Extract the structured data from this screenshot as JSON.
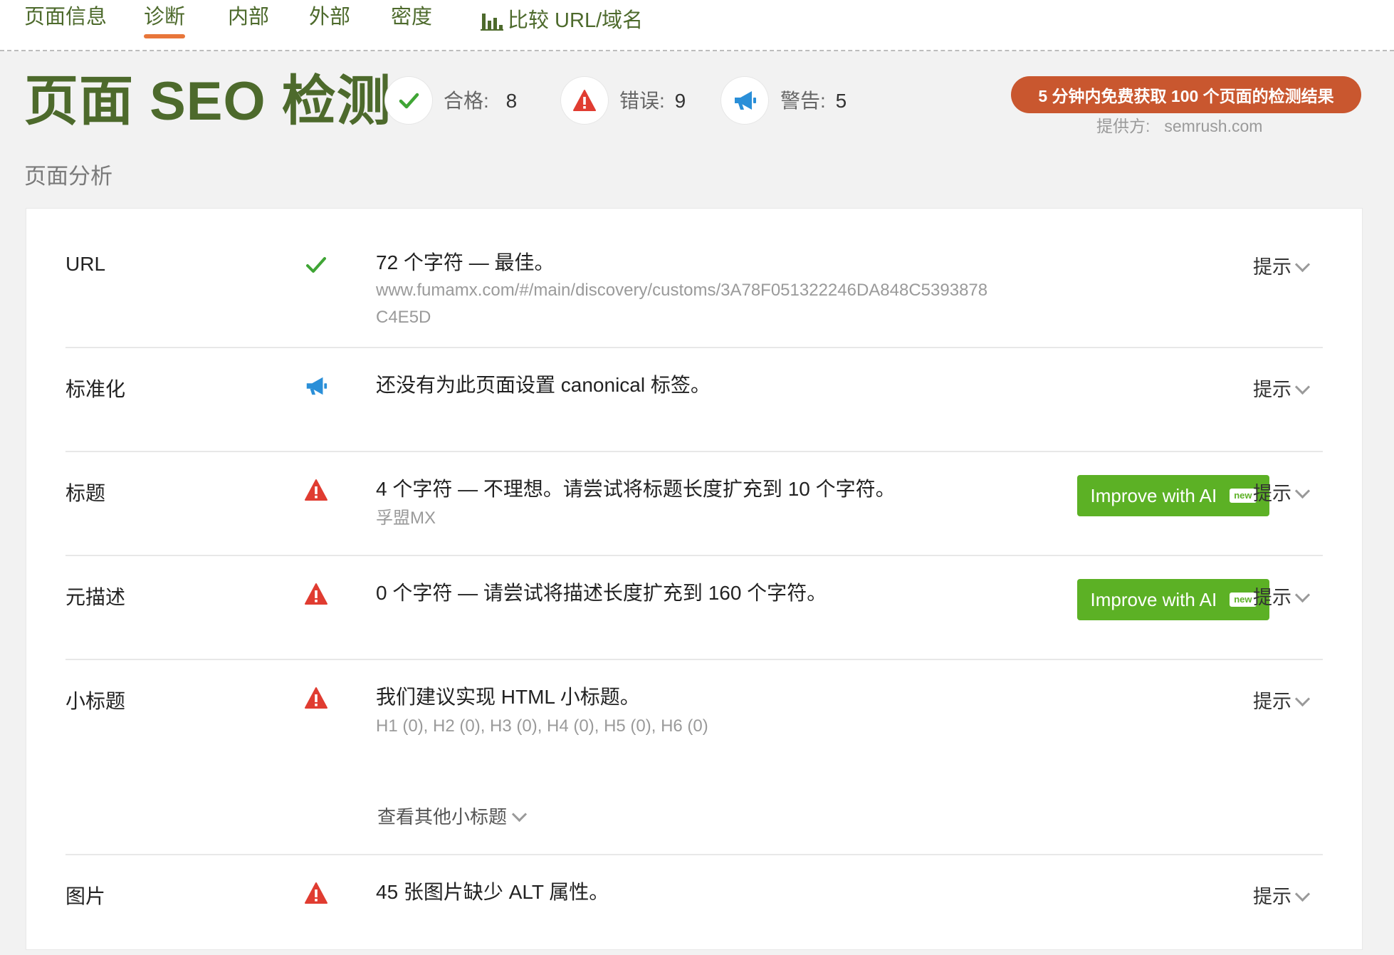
{
  "nav": {
    "items": [
      "页面信息",
      "诊断",
      "内部",
      "外部",
      "密度"
    ],
    "active": "诊断",
    "compare_label": "比较 URL/域名"
  },
  "header": {
    "title": "页面 SEO 检测",
    "stats": {
      "pass_label": "合格:",
      "pass_count": "8",
      "error_label": "错误:",
      "error_count": "9",
      "warning_label": "警告:",
      "warning_count": "5"
    },
    "promo_label": "5 分钟内免费获取 100 个页面的检测结果",
    "provider_label": "提供方:",
    "provider_host": "semrush.com"
  },
  "section_title": "页面分析",
  "hint_label": "提示",
  "improve_label": "Improve with AI",
  "new_badge": "new",
  "rows": [
    {
      "label": "URL",
      "status": "pass",
      "icon": "check-icon",
      "message": "72 个字符 — 最佳。",
      "details": [
        "www.fumamx.com/#/main/discovery/customs/3A78F051322246DA848C5393878",
        "C4E5D"
      ]
    },
    {
      "label": "标准化",
      "status": "warning",
      "icon": "megaphone-icon",
      "message": "还没有为此页面设置 canonical 标签。"
    },
    {
      "label": "标题",
      "status": "error",
      "icon": "warning-triangle-icon",
      "message": "4 个字符 — 不理想。请尝试将标题长度扩充到 10 个字符。",
      "details": [
        "孚盟MX"
      ]
    },
    {
      "label": "元描述",
      "status": "error",
      "icon": "warning-triangle-icon",
      "message": "0 个字符 — 请尝试将描述长度扩充到 160 个字符。"
    },
    {
      "label": "小标题",
      "status": "error",
      "icon": "warning-triangle-icon",
      "message": "我们建议实现 HTML 小标题。",
      "details": [
        "H1 (0), H2 (0), H3 (0), H4 (0), H5 (0), H6 (0)"
      ],
      "more_label": "查看其他小标题"
    },
    {
      "label": "图片",
      "status": "error",
      "icon": "warning-triangle-icon",
      "message": "45 张图片缺少 ALT 属性。"
    }
  ],
  "colors": {
    "brand_green": "#4d6a2c",
    "active_underline": "#e8763a",
    "promo": "#c9572f",
    "pass": "#3fa535",
    "error": "#e03c31",
    "warning": "#2a8fd8",
    "ai_button": "#5cb125"
  }
}
